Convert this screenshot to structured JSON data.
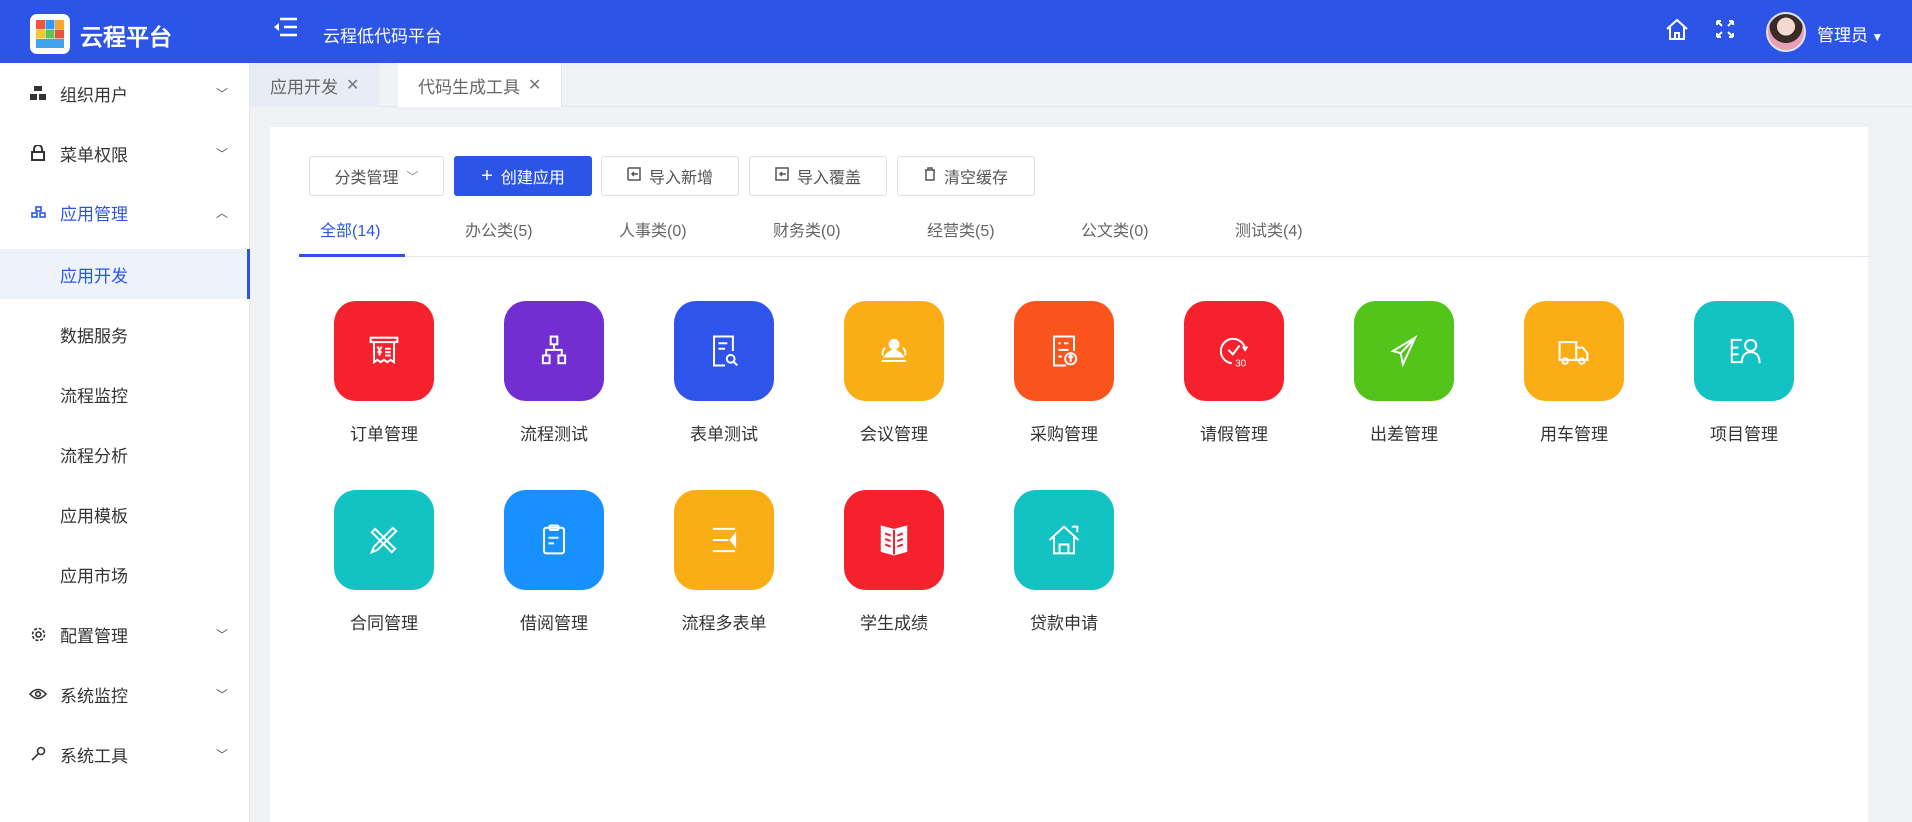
{
  "header": {
    "brand": "云程平台",
    "subtitle": "云程低代码平台",
    "user": "管理员"
  },
  "sidebar": {
    "items": [
      {
        "label": "组织用户",
        "icon": "org-icon"
      },
      {
        "label": "菜单权限",
        "icon": "lock-icon"
      },
      {
        "label": "应用管理",
        "icon": "app-tree-icon"
      },
      {
        "label": "应用开发"
      },
      {
        "label": "数据服务"
      },
      {
        "label": "流程监控"
      },
      {
        "label": "流程分析"
      },
      {
        "label": "应用模板"
      },
      {
        "label": "应用市场"
      },
      {
        "label": "配置管理",
        "icon": "gear-icon"
      },
      {
        "label": "系统监控",
        "icon": "eye-icon"
      },
      {
        "label": "系统工具",
        "icon": "wrench-icon"
      }
    ]
  },
  "page_tabs": [
    {
      "label": "应用开发"
    },
    {
      "label": "代码生成工具"
    }
  ],
  "toolbar": {
    "category": "分类管理",
    "create": "创建应用",
    "import_new": "导入新增",
    "import_overwrite": "导入覆盖",
    "clear_cache": "清空缓存"
  },
  "category_tabs": [
    "全部(14)",
    "办公类(5)",
    "人事类(0)",
    "财务类(0)",
    "经营类(5)",
    "公文类(0)",
    "测试类(4)"
  ],
  "apps": [
    {
      "name": "订单管理",
      "color": "#f5222d"
    },
    {
      "name": "流程测试",
      "color": "#722ed1"
    },
    {
      "name": "表单测试",
      "color": "#2f54eb"
    },
    {
      "name": "会议管理",
      "color": "#faad14"
    },
    {
      "name": "采购管理",
      "color": "#fa541c"
    },
    {
      "name": "请假管理",
      "color": "#f5222d"
    },
    {
      "name": "出差管理",
      "color": "#52c41a"
    },
    {
      "name": "用车管理",
      "color": "#faad14"
    },
    {
      "name": "项目管理",
      "color": "#13c2c2"
    },
    {
      "name": "合同管理",
      "color": "#13c2c2"
    },
    {
      "name": "借阅管理",
      "color": "#1890ff"
    },
    {
      "name": "流程多表单",
      "color": "#faad14"
    },
    {
      "name": "学生成绩",
      "color": "#f5222d"
    },
    {
      "name": "贷款申请",
      "color": "#13c2c2"
    }
  ]
}
